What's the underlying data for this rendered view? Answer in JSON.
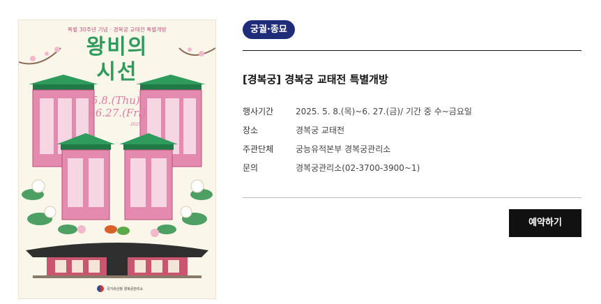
{
  "poster": {
    "top_line": "특별 30주년 기념 · 경복궁 교태전 특별개방",
    "title_line1": "왕비의",
    "title_line2": "시선",
    "date_line1": "5.8.(Thu)",
    "date_line2": "- 6.27.(Fri)",
    "year": "2025",
    "logo_text": "국가유산청 경복궁관리소",
    "colors": {
      "background": "#fbf6ea",
      "pink": "#e48aae",
      "green": "#2e9b5c",
      "roof": "#2f2f2f"
    }
  },
  "badge": {
    "label": "궁궐·종묘",
    "color": "#1f2d78"
  },
  "event": {
    "title": "[경복궁] 경복궁 교태전 특별개방",
    "details": [
      {
        "key": "행사기간",
        "value": "2025. 5. 8.(목)~6. 27.(금)/ 기간 중 수~금요일"
      },
      {
        "key": "장소",
        "value": "경복궁 교태전"
      },
      {
        "key": "주관단체",
        "value": "궁능유적본부 경복궁관리소"
      },
      {
        "key": "문의",
        "value": "경복궁관리소(02-3700-3900~1)"
      }
    ]
  },
  "reserve_button": {
    "label": "예약하기",
    "color": "#111111"
  }
}
